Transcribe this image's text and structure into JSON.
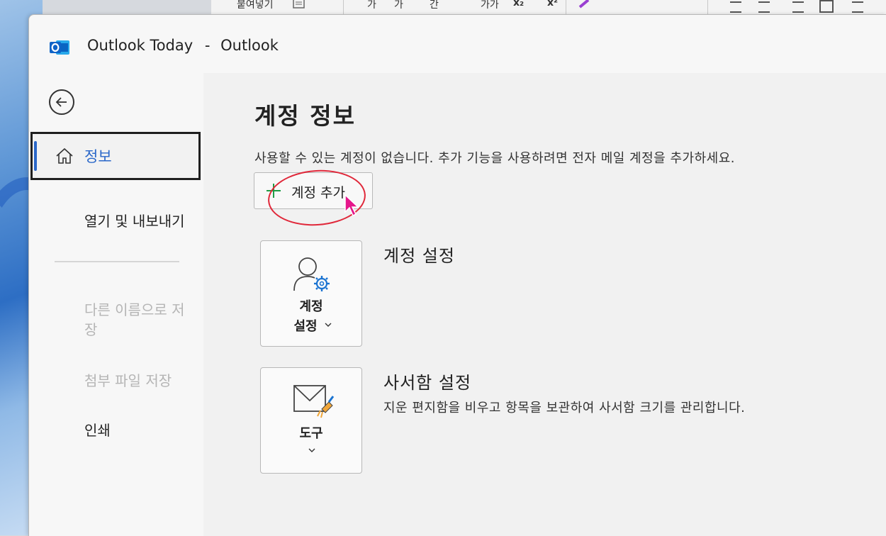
{
  "background_app": {
    "paste_label": "붙여넣기",
    "format_a": "가",
    "format_b": "가",
    "format_c": "간",
    "format_d": "가가",
    "subscript": "x₂",
    "superscript": "x²"
  },
  "window": {
    "app_title": "Outlook Today",
    "separator": "-",
    "app_name": "Outlook"
  },
  "nav": {
    "selected_label": "정보",
    "items": [
      {
        "label": "열기 및 내보내기",
        "disabled": false
      },
      {
        "label": "다른 이름으로 저장",
        "disabled": true
      },
      {
        "label": "첨부 파일 저장",
        "disabled": true
      },
      {
        "label": "인쇄",
        "disabled": false
      }
    ]
  },
  "content": {
    "heading": "계정 정보",
    "description": "사용할 수 있는 계정이 없습니다. 추가 기능을 사용하려면 전자 메일 계정을 추가하세요.",
    "add_account_label": "계정 추가",
    "account_settings": {
      "card_label_line1": "계정",
      "card_label_line2": "설정",
      "title": "계정 설정"
    },
    "mailbox_settings": {
      "card_label": "도구",
      "title": "사서함 설정",
      "description": "지운 편지함을 비우고 항목을 보관하여 사서함 크기를 관리합니다."
    }
  },
  "colors": {
    "accent": "#2a67c9",
    "highlight_ellipse": "#e0283a",
    "add_plus": "#1f9c46",
    "cursor": "#e5168b"
  }
}
